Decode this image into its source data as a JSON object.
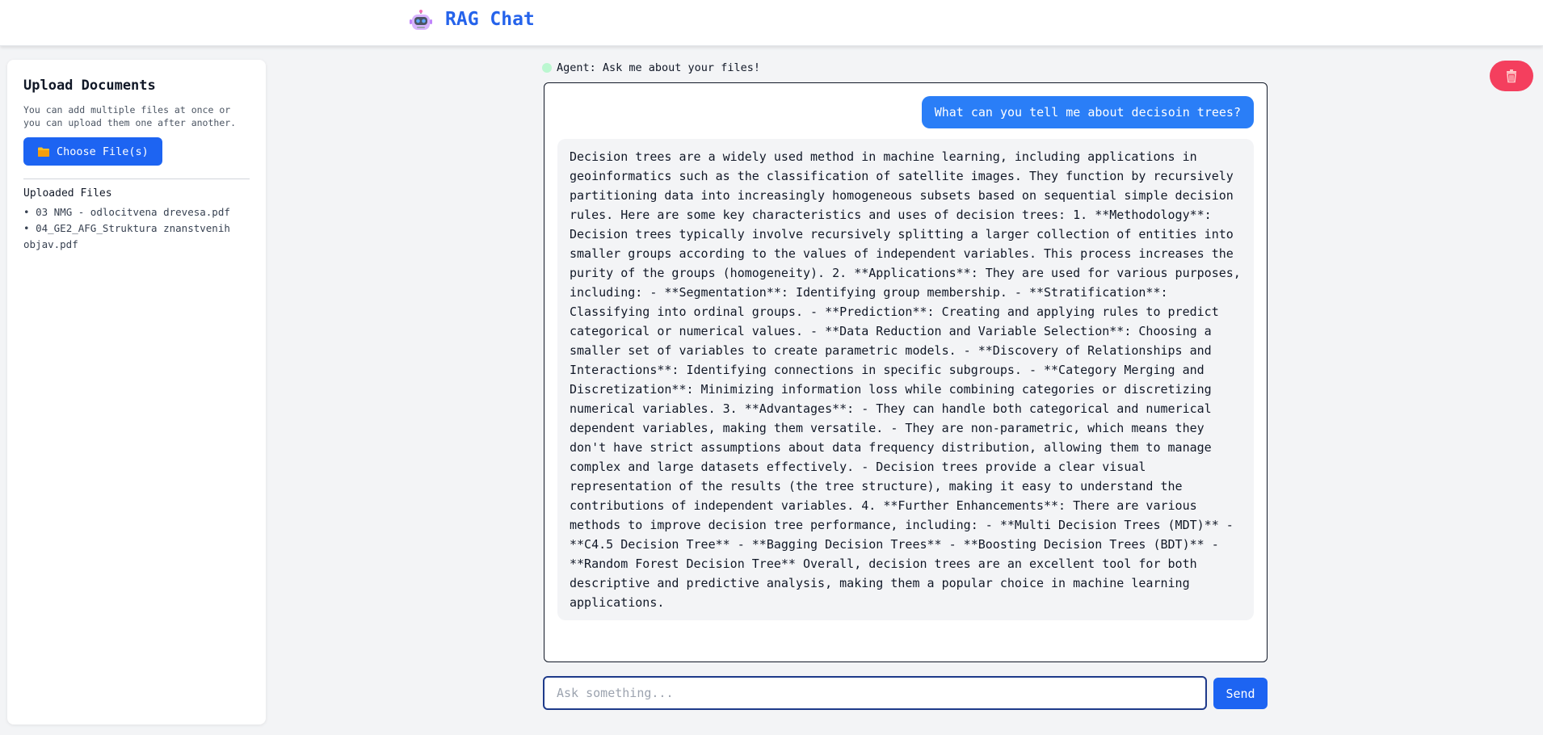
{
  "header": {
    "title": "RAG Chat",
    "logo_icon": "robot-icon"
  },
  "sidebar": {
    "title": "Upload Documents",
    "description": "You can add multiple files at once or you can upload them one after another.",
    "choose_button": "Choose File(s)",
    "choose_icon": "folder-icon",
    "uploaded_title": "Uploaded Files",
    "files": [
      "03 NMG - odlocitvena drevesa.pdf",
      "04_GE2_AFG_Struktura znanstvenih objav.pdf"
    ]
  },
  "chat": {
    "agent_status": "Agent: Ask me about your files!",
    "messages": [
      {
        "role": "user",
        "text": "What can you tell me about decisoin trees?"
      },
      {
        "role": "assistant",
        "text": "Decision trees are a widely used method in machine learning, including applications in geoinformatics such as the classification of satellite images. They function by recursively partitioning data into increasingly homogeneous subsets based on sequential simple decision rules. Here are some key characteristics and uses of decision trees: 1. **Methodology**: Decision trees typically involve recursively splitting a larger collection of entities into smaller groups according to the values of independent variables. This process increases the purity of the groups (homogeneity). 2. **Applications**: They are used for various purposes, including: - **Segmentation**: Identifying group membership. - **Stratification**: Classifying into ordinal groups. - **Prediction**: Creating and applying rules to predict categorical or numerical values. - **Data Reduction and Variable Selection**: Choosing a smaller set of variables to create parametric models. - **Discovery of Relationships and Interactions**: Identifying connections in specific subgroups. - **Category Merging and Discretization**: Minimizing information loss while combining categories or discretizing numerical variables. 3. **Advantages**: - They can handle both categorical and numerical dependent variables, making them versatile. - They are non-parametric, which means they don't have strict assumptions about data frequency distribution, allowing them to manage complex and large datasets effectively. - Decision trees provide a clear visual representation of the results (the tree structure), making it easy to understand the contributions of independent variables. 4. **Further Enhancements**: There are various methods to improve decision tree performance, including: - **Multi Decision Trees (MDT)** - **C4.5 Decision Tree** - **Bagging Decision Trees** - **Boosting Decision Trees (BDT)** - **Random Forest Decision Tree** Overall, decision trees are an excellent tool for both descriptive and predictive analysis, making them a popular choice in machine learning applications."
      }
    ],
    "input_placeholder": "Ask something...",
    "input_value": "",
    "send_label": "Send",
    "clear_icon": "trash-icon"
  },
  "colors": {
    "accent": "#1d64f2",
    "title": "#2563eb",
    "user_bubble": "#2a7ef7",
    "danger": "#f43f5e",
    "status_dot": "#bbf7d0"
  }
}
